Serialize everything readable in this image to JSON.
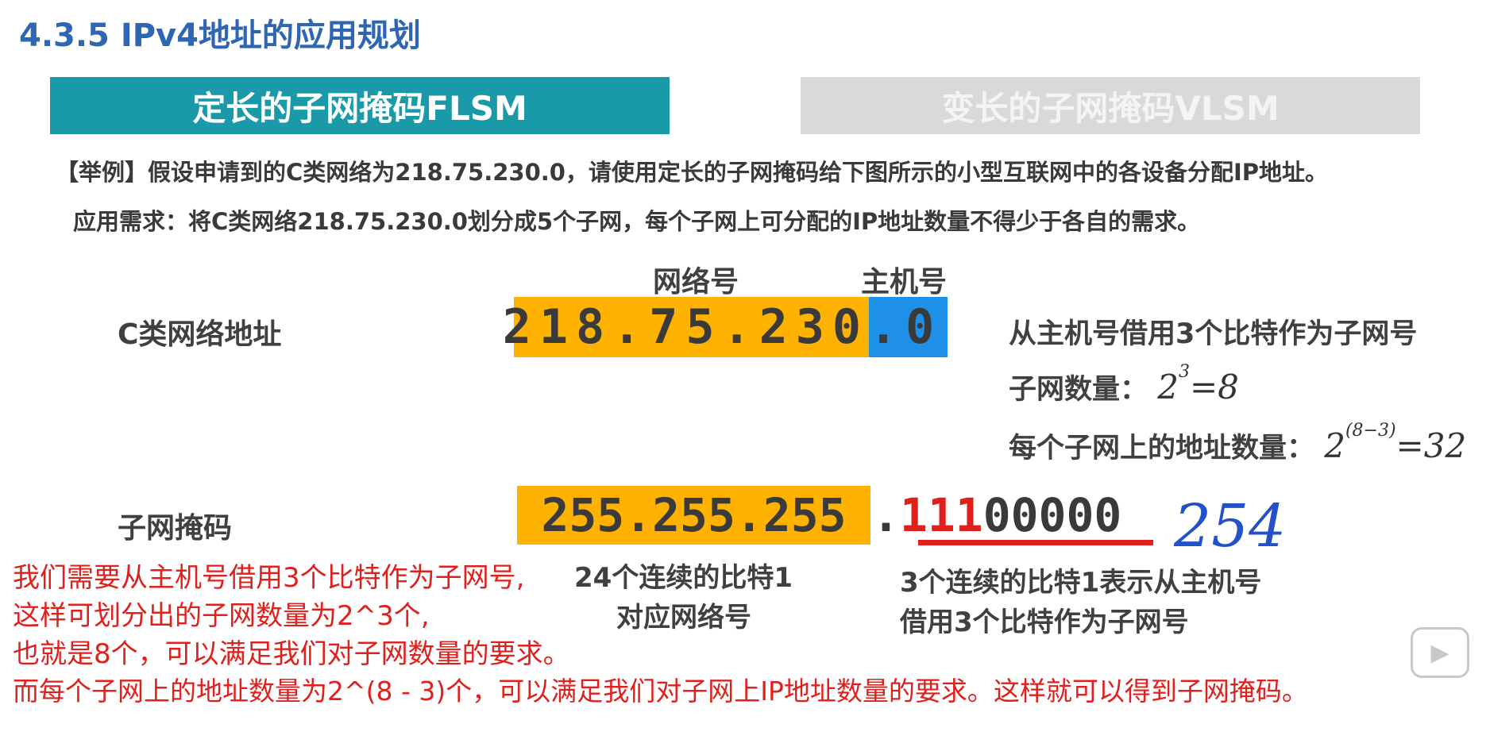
{
  "title": "4.3.5 IPv4地址的应用规划",
  "tabs": {
    "flsm": "定长的子网掩码FLSM",
    "vlsm": "变长的子网掩码VLSM"
  },
  "example": "【举例】假设申请到的C类网络为218.75.230.0，请使用定长的子网掩码给下图所示的小型互联网中的各设备分配IP地址。",
  "requirement": "应用需求：将C类网络218.75.230.0划分成5个子网，每个子网上可分配的IP地址数量不得少于各自的需求。",
  "labels": {
    "network_part": "网络号",
    "host_part": "主机号",
    "class_c_address": "C类网络地址",
    "subnet_mask": "子网掩码"
  },
  "address": {
    "network": "218.75.230",
    "host": ".0"
  },
  "mask": {
    "network": "255.255.255",
    "dot": ".",
    "borrowed_bits": "111",
    "host_bits": "00000"
  },
  "info": {
    "borrow": "从主机号借用3个比特作为子网号",
    "subnet_count_label": "子网数量：",
    "subnet_count_base": "2",
    "subnet_count_exp": "3",
    "subnet_count_result": "=8",
    "addr_count_label": "每个子网上的地址数量：",
    "addr_count_base": "2",
    "addr_count_exp": "(8−3)",
    "addr_count_result": "=32"
  },
  "notes": {
    "bits24_line1": "24个连续的比特1",
    "bits24_line2": "对应网络号",
    "bits3_line1": "3个连续的比特1表示从主机号",
    "bits3_line2": "借用3个比特作为子网号"
  },
  "handwritten": "254",
  "annotations": [
    "我们需要从主机号借用3个比特作为子网号,",
    "这样可划分出的子网数量为2^3个,",
    "也就是8个，可以满足我们对子网数量的要求。",
    "而每个子网上的地址数量为2^(8 - 3)个，可以满足我们对子网上IP地址数量的要求。这样就可以得到子网掩码。"
  ],
  "colors": {
    "title": "#2f66b3",
    "tab_active": "#1a9aa8",
    "tab_inactive": "#d9d9d9",
    "network_highlight": "#ffb300",
    "host_highlight": "#1e90e8",
    "annotation": "#e0201c",
    "handwriting": "#2451c9"
  },
  "icons": {
    "player": "play-icon"
  }
}
